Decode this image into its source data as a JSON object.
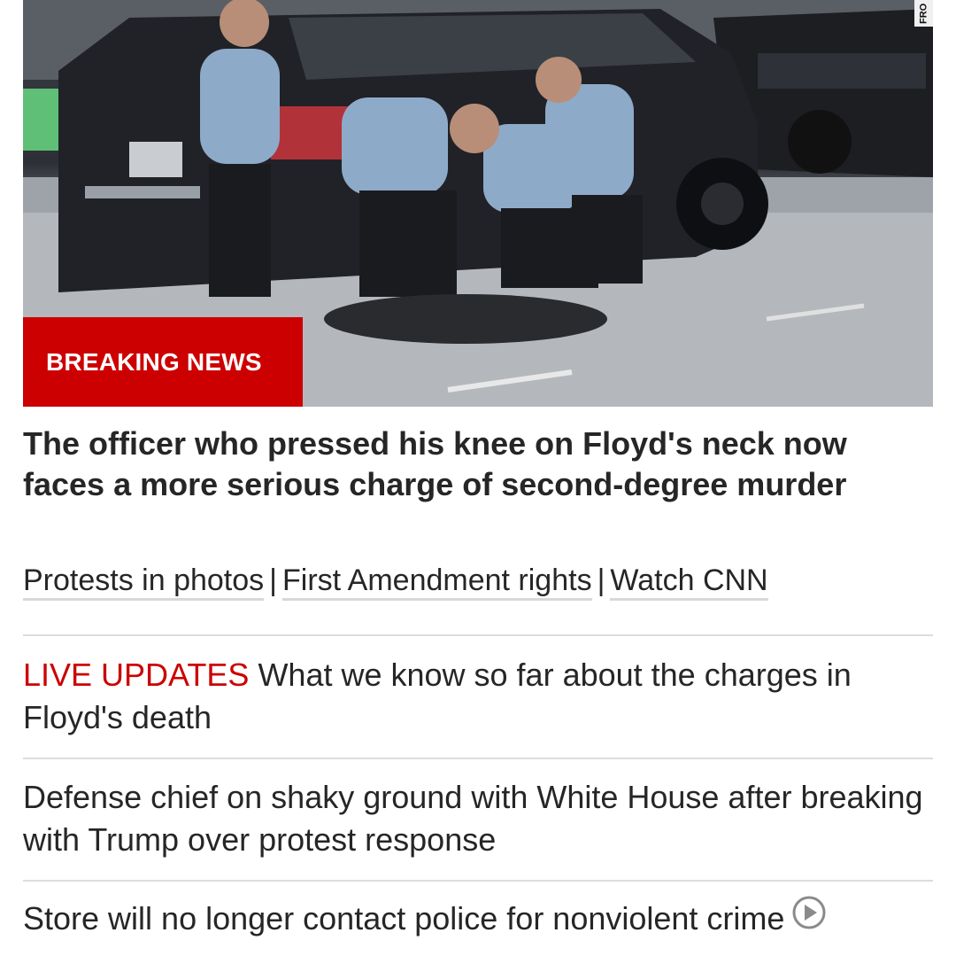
{
  "hero": {
    "badge_label": "BREAKING NEWS",
    "watermark_text": "FRO"
  },
  "headline": "The officer who pressed his knee on Floyd's neck now faces a more serious charge of second-degree murder",
  "related_links": [
    {
      "label": "Protests in photos"
    },
    {
      "label": "First Amendment rights"
    },
    {
      "label": "Watch CNN"
    }
  ],
  "related_separator": "|",
  "stories": [
    {
      "tag": "LIVE UPDATES",
      "title": "What we know so far about the charges in Floyd's death"
    },
    {
      "title": "Defense chief on shaky ground with White House after breaking with Trump over protest response"
    },
    {
      "title": "Store will no longer contact police for nonviolent crime",
      "icon": "play-circle-icon"
    }
  ],
  "colors": {
    "accent_red": "#cc0000",
    "text": "#262626",
    "divider": "#dcdcdc"
  }
}
